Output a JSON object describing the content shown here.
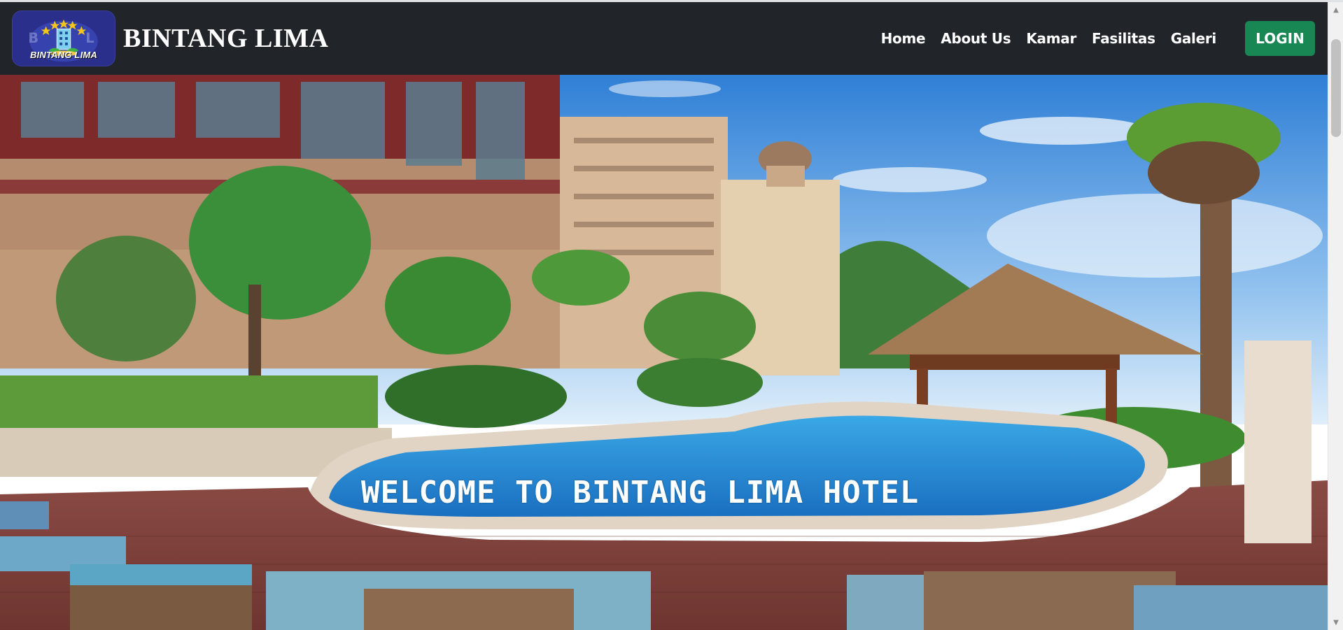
{
  "brand": {
    "title": "BINTANG LIMA",
    "logo_text": "BINTANG LIMA",
    "logo_icon": "hotel-star-logo"
  },
  "nav": {
    "items": [
      {
        "label": "Home"
      },
      {
        "label": "About Us"
      },
      {
        "label": "Kamar"
      },
      {
        "label": "Fasilitas"
      },
      {
        "label": "Galeri"
      }
    ],
    "login_label": "LOGIN"
  },
  "hero": {
    "title": "WELCOME TO BINTANG LIMA HOTEL",
    "image": "resort-pool-photo"
  },
  "colors": {
    "navbar_bg": "#212529",
    "login_bg": "#198754",
    "text": "#ffffff"
  },
  "icons": {
    "scroll_up": "chevron-up-icon",
    "scroll_down": "chevron-down-icon"
  }
}
